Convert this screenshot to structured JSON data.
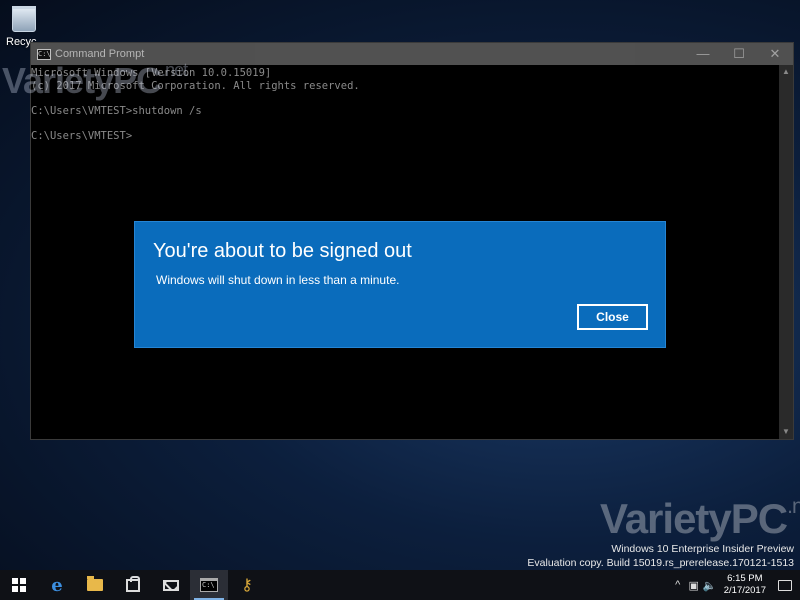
{
  "desktop": {
    "recycle_bin_label": "Recyc"
  },
  "cmd_window": {
    "title": "Command Prompt",
    "icon_text": "C:\\",
    "controls": {
      "minimize": "—",
      "maximize": "☐",
      "close": "✕"
    },
    "lines": [
      "Microsoft Windows [Version 10.0.15019]",
      "(c) 2017 Microsoft Corporation. All rights reserved.",
      "",
      "C:\\Users\\VMTEST>shutdown /s",
      "",
      "C:\\Users\\VMTEST>"
    ]
  },
  "dialog": {
    "title": "You're about to be signed out",
    "message": "Windows will shut down in less than a minute.",
    "close_label": "Close"
  },
  "watermark": {
    "brand": "VarietyPC",
    "suffix": ".net"
  },
  "build_info": {
    "line1": "Windows 10 Enterprise Insider Preview",
    "line2": "Evaluation copy. Build 15019.rs_prerelease.170121-1513"
  },
  "taskbar": {
    "items": [
      {
        "name": "start",
        "label": "Start"
      },
      {
        "name": "edge",
        "label": "Microsoft Edge"
      },
      {
        "name": "file-explorer",
        "label": "File Explorer"
      },
      {
        "name": "store",
        "label": "Store"
      },
      {
        "name": "mail",
        "label": "Mail"
      },
      {
        "name": "command-prompt",
        "label": "Command Prompt"
      },
      {
        "name": "keys",
        "label": "Keys"
      }
    ],
    "clock": {
      "time": "6:15 PM",
      "date": "2/17/2017"
    }
  },
  "colors": {
    "dialog_bg": "#0a6cbc",
    "console_bg": "#000000",
    "taskbar_bg": "#0f1116",
    "console_text": "#8a8a8a"
  }
}
